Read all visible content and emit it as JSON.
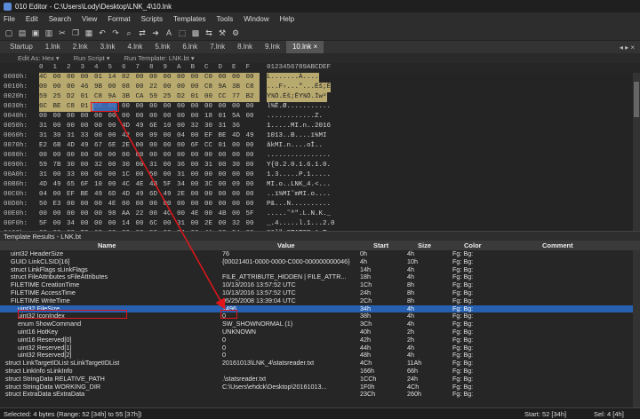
{
  "window": {
    "title": "010 Editor - C:\\Users\\Lody\\Desktop\\LNK_4\\10.lnk"
  },
  "menu": [
    "File",
    "Edit",
    "Search",
    "View",
    "Format",
    "Scripts",
    "Templates",
    "Tools",
    "Window",
    "Help"
  ],
  "tabs": [
    "Startup",
    "1.lnk",
    "2.lnk",
    "3.lnk",
    "4.lnk",
    "5.lnk",
    "6.lnk",
    "7.lnk",
    "8.lnk",
    "9.lnk",
    "10.lnk ×"
  ],
  "active_tab": 10,
  "subbar": [
    "Edit As: Hex ▾",
    "Run Script ▾",
    "Run Template: LNK.bt ▾"
  ],
  "hex": {
    "columns": [
      "0",
      "1",
      "2",
      "3",
      "4",
      "5",
      "6",
      "7",
      "8",
      "9",
      "A",
      "B",
      "C",
      "D",
      "E",
      "F"
    ],
    "ascii_header": "0123456789ABCDEF",
    "rows": [
      {
        "addr": "0000h:",
        "bytes": [
          "4C",
          "00",
          "00",
          "00",
          "01",
          "14",
          "02",
          "00",
          "00",
          "00",
          "00",
          "00",
          "C0",
          "00",
          "00",
          "00"
        ],
        "ascii": "L.......À...."
      },
      {
        "addr": "0010h:",
        "bytes": [
          "00",
          "00",
          "00",
          "46",
          "9B",
          "00",
          "08",
          "00",
          "22",
          "00",
          "00",
          "00",
          "C8",
          "9A",
          "3B",
          "C8"
        ],
        "ascii": "...F›...\"...Èš;È"
      },
      {
        "addr": "0020h:",
        "bytes": [
          "59",
          "25",
          "D2",
          "01",
          "C8",
          "9A",
          "3B",
          "CA",
          "59",
          "25",
          "D2",
          "01",
          "00",
          "CC",
          "77",
          "B2"
        ],
        "ascii": "Y%Ò.Èš;ÊY%Ò.Ìw²"
      },
      {
        "addr": "0030h:",
        "bytes": [
          "6C",
          "BE",
          "C8",
          "01",
          "D8",
          "05",
          "00",
          "00",
          "00",
          "00",
          "00",
          "00",
          "00",
          "00",
          "00",
          "00"
        ],
        "ascii": "l¾È.Ø..........."
      },
      {
        "addr": "0040h:",
        "bytes": [
          "00",
          "00",
          "00",
          "00",
          "00",
          "00",
          "00",
          "00",
          "00",
          "00",
          "00",
          "00",
          "18",
          "01",
          "5A",
          "00"
        ],
        "ascii": "............Z."
      },
      {
        "addr": "0050h:",
        "bytes": [
          "31",
          "00",
          "00",
          "00",
          "00",
          "00",
          "4D",
          "49",
          "6E",
          "10",
          "00",
          "32",
          "30",
          "31",
          "36"
        ],
        "ascii": "1.....MI.n..2016"
      },
      {
        "addr": "0060h:",
        "bytes": [
          "31",
          "30",
          "31",
          "33",
          "00",
          "00",
          "42",
          "00",
          "09",
          "00",
          "04",
          "00",
          "EF",
          "BE",
          "4D",
          "49"
        ],
        "ascii": "1013..B....ï¾MI"
      },
      {
        "addr": "0070h:",
        "bytes": [
          "E2",
          "6B",
          "4D",
          "49",
          "67",
          "6E",
          "2E",
          "00",
          "00",
          "00",
          "00",
          "6F",
          "CC",
          "01",
          "00",
          "00"
        ],
        "ascii": "âkMI.n....oÌ.."
      },
      {
        "addr": "0080h:",
        "bytes": [
          "00",
          "00",
          "00",
          "00",
          "00",
          "00",
          "00",
          "00",
          "00",
          "00",
          "00",
          "00",
          "00",
          "00",
          "00",
          "00"
        ],
        "ascii": "................"
      },
      {
        "addr": "0090h:",
        "bytes": [
          "59",
          "7B",
          "30",
          "00",
          "32",
          "00",
          "30",
          "00",
          "31",
          "00",
          "36",
          "00",
          "31",
          "00",
          "30",
          "00"
        ],
        "ascii": "Y{0.2.0.1.6.1.0."
      },
      {
        "addr": "00A0h:",
        "bytes": [
          "31",
          "00",
          "33",
          "00",
          "00",
          "00",
          "1C",
          "00",
          "50",
          "00",
          "31",
          "00",
          "00",
          "00",
          "00",
          "00"
        ],
        "ascii": "1.3.....P.1....."
      },
      {
        "addr": "00B0h:",
        "bytes": [
          "4D",
          "49",
          "65",
          "6F",
          "10",
          "00",
          "4C",
          "4E",
          "4B",
          "5F",
          "34",
          "00",
          "3C",
          "00",
          "09",
          "00"
        ],
        "ascii": "MI.o..LNK_4.<..."
      },
      {
        "addr": "00C0h:",
        "bytes": [
          "04",
          "00",
          "EF",
          "BE",
          "49",
          "6D",
          "4D",
          "49",
          "6D",
          "49",
          "2E",
          "00",
          "00",
          "00",
          "00",
          "00"
        ],
        "ascii": "..ï¾MI˜mMI.o...."
      },
      {
        "addr": "00D0h:",
        "bytes": [
          "50",
          "E3",
          "00",
          "00",
          "00",
          "4E",
          "00",
          "00",
          "00",
          "00",
          "00",
          "00",
          "00",
          "00",
          "00",
          "00"
        ],
        "ascii": "P&...N.........."
      },
      {
        "addr": "00E0h:",
        "bytes": [
          "00",
          "00",
          "00",
          "00",
          "00",
          "98",
          "AA",
          "22",
          "00",
          "4C",
          "00",
          "4E",
          "00",
          "4B",
          "00",
          "5F"
        ],
        "ascii": ".....˜ª\".L.N.K._"
      },
      {
        "addr": "00F0h:",
        "bytes": [
          "5F",
          "00",
          "34",
          "00",
          "00",
          "00",
          "14",
          "00",
          "6C",
          "00",
          "31",
          "00",
          "2E",
          "00",
          "32",
          "00"
        ],
        "ascii": "_.4.....l.1...2.0"
      },
      {
        "addr": "0100h:",
        "bytes": [
          "33",
          "00",
          "38",
          "E2",
          "6C",
          "00",
          "22",
          "00",
          "53",
          "00",
          "54",
          "00",
          "41",
          "00",
          "54",
          "00"
        ],
        "ascii": "3&l\".STATSR-1.T"
      }
    ]
  },
  "template": {
    "title": "Template Results - LNK.bt",
    "headers": {
      "name": "Name",
      "value": "Value",
      "start": "Start",
      "size": "Size",
      "color": "Color",
      "comment": "Comment"
    },
    "rows": [
      {
        "name": "uint32 HeaderSize",
        "value": "76",
        "start": "0h",
        "size": "4h",
        "color": "Fg:   Bg:"
      },
      {
        "name": "GUID LinkCLSID[16]",
        "value": "{00021401-0000-0000-C000-000000000046}",
        "start": "4h",
        "size": "10h",
        "color": "Fg:   Bg:"
      },
      {
        "name": "struct LinkFlags sLinkFlags",
        "value": "",
        "start": "14h",
        "size": "4h",
        "color": "Fg:   Bg:"
      },
      {
        "name": "struct FileAttributes sFileAttributes",
        "value": "FILE_ATTRIBUTE_HIDDEN | FILE_ATTR...",
        "start": "18h",
        "size": "4h",
        "color": "Fg:   Bg:"
      },
      {
        "name": "FILETIME CreationTime",
        "value": "10/13/2016 13:57:52 UTC",
        "start": "1Ch",
        "size": "8h",
        "color": "Fg:   Bg:"
      },
      {
        "name": "FILETIME AccessTime",
        "value": "10/13/2016 13:57:52 UTC",
        "start": "24h",
        "size": "8h",
        "color": "Fg:   Bg:"
      },
      {
        "name": "FILETIME WriteTime",
        "value": "05/25/2008 13:39:04 UTC",
        "start": "2Ch",
        "size": "8h",
        "color": "Fg:   Bg:"
      },
      {
        "name": "uint32 FileSize",
        "value": "1496",
        "start": "34h",
        "size": "4h",
        "color": "Fg:   Bg:"
      },
      {
        "name": "uint32 IconIndex",
        "value": "0",
        "start": "38h",
        "size": "4h",
        "color": "Fg:   Bg:"
      },
      {
        "name": "enum ShowCommand",
        "value": "SW_SHOWNORMAL (1)",
        "start": "3Ch",
        "size": "4h",
        "color": "Fg:   Bg:"
      },
      {
        "name": "uint16 HotKey",
        "value": "UNKNOWN",
        "start": "40h",
        "size": "2h",
        "color": "Fg:   Bg:"
      },
      {
        "name": "uint16 Reserved[0]",
        "value": "0",
        "start": "42h",
        "size": "2h",
        "color": "Fg:   Bg:"
      },
      {
        "name": "uint32 Reserved[1]",
        "value": "0",
        "start": "44h",
        "size": "4h",
        "color": "Fg:   Bg:"
      },
      {
        "name": "uint32 Reserved[2]",
        "value": "0",
        "start": "48h",
        "size": "4h",
        "color": "Fg:   Bg:"
      },
      {
        "name": "struct LinkTargetIDList sLinkTargetIDList",
        "value": "20161013\\LNK_4\\statsreader.txt",
        "start": "4Ch",
        "size": "11Ah",
        "color": "Fg:   Bg:"
      },
      {
        "name": "struct LinkInfo sLinkInfo",
        "value": "",
        "start": "166h",
        "size": "66h",
        "color": "Fg:   Bg:"
      },
      {
        "name": "struct StringData RELATIVE_PATH",
        "value": ".\\statsreader.txt",
        "start": "1CCh",
        "size": "24h",
        "color": "Fg:   Bg:"
      },
      {
        "name": "struct StringData WORKING_DIR",
        "value": "C:\\Users\\ehdck\\Desktop\\20161013...",
        "start": "1F0h",
        "size": "4Ch",
        "color": "Fg:   Bg:"
      },
      {
        "name": "struct ExtraData sExtraData",
        "value": "",
        "start": "23Ch",
        "size": "260h",
        "color": "Fg:   Bg:"
      }
    ]
  },
  "status": {
    "left": "Selected: 4 bytes (Range: 52 [34h] to 55 [37h])",
    "start": "Start: 52 [34h]",
    "sel": "Sel: 4 [4h]"
  },
  "colors": {
    "highlight": "#b8a96e",
    "selection": "#2760b0",
    "annotation": "#e0161b"
  }
}
